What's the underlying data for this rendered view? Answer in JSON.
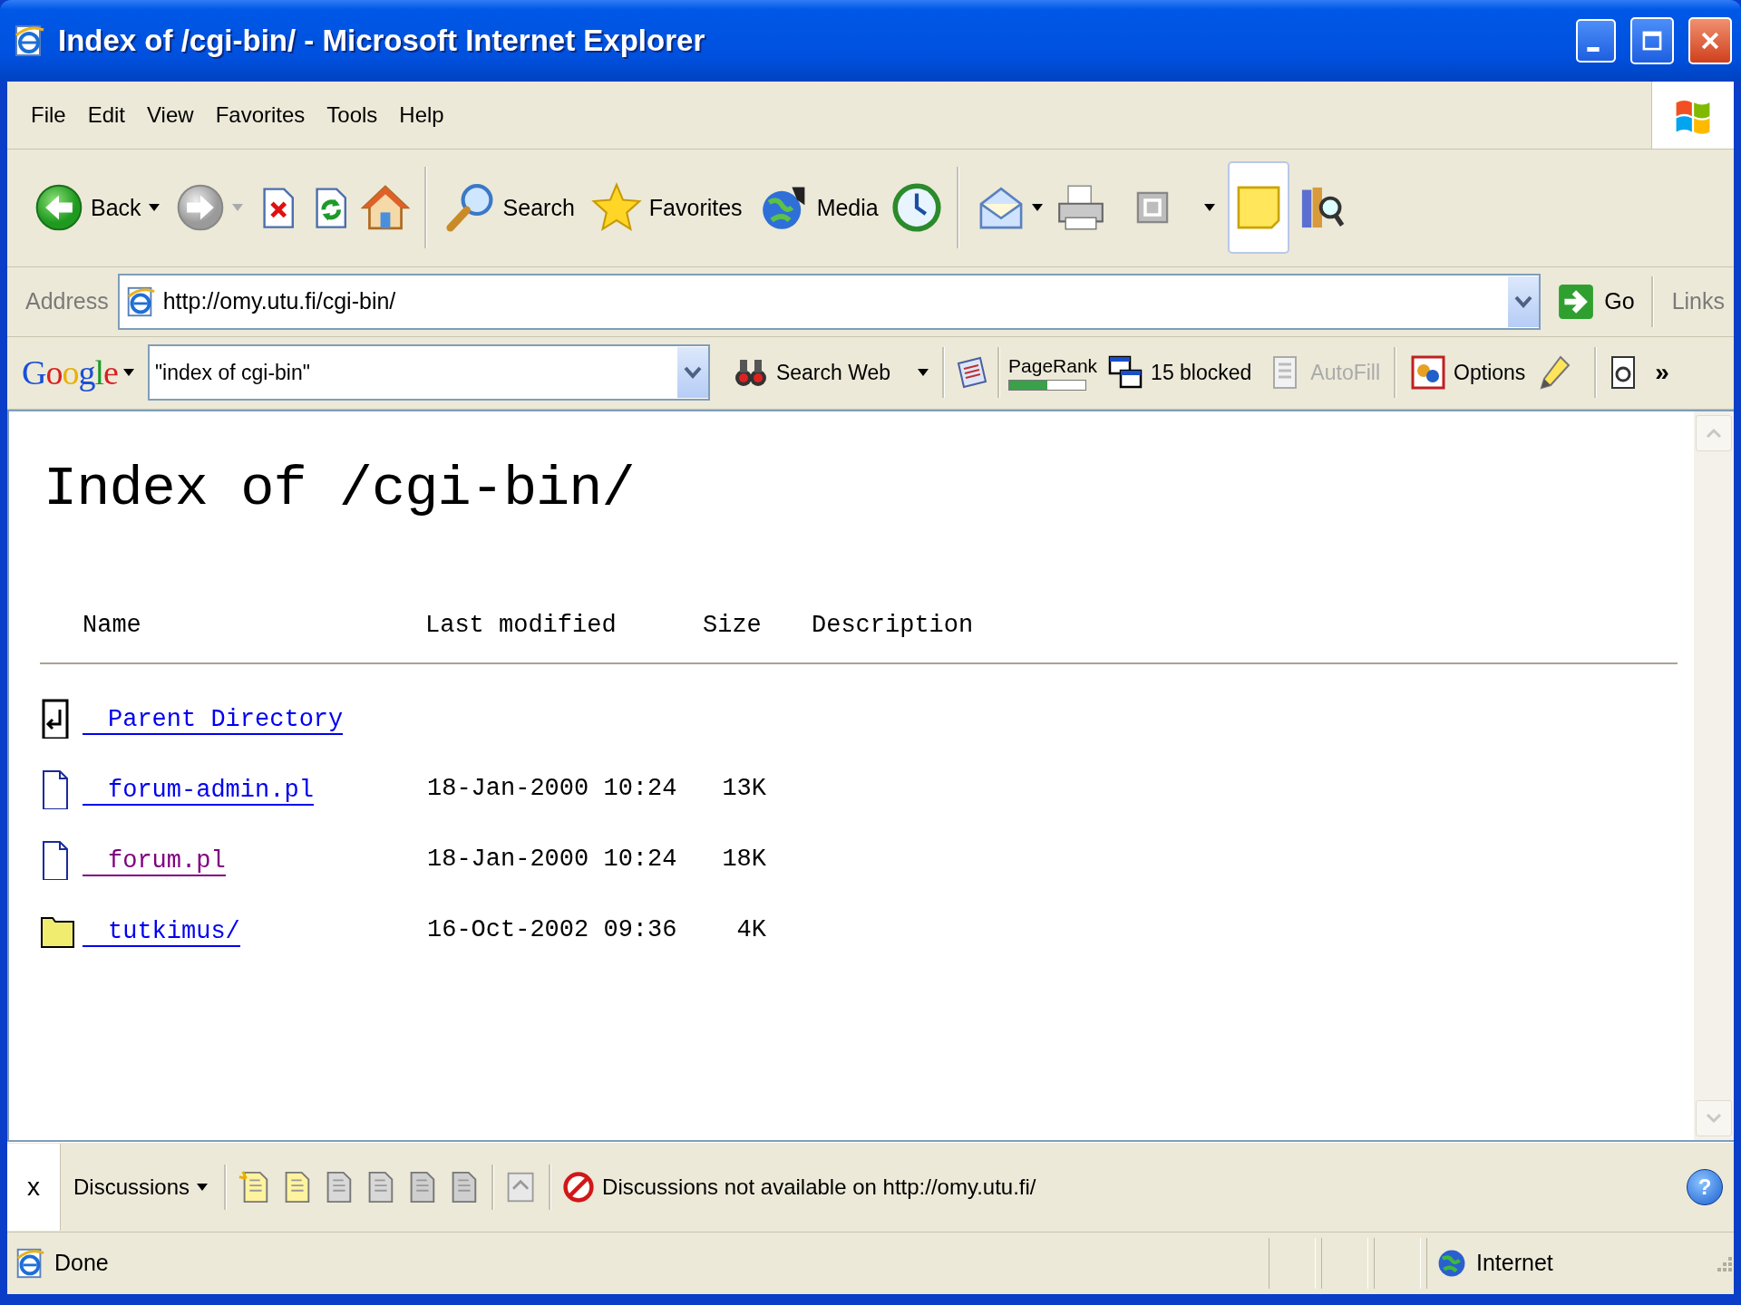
{
  "window": {
    "title": "Index of /cgi-bin/ - Microsoft Internet Explorer"
  },
  "menu": [
    "File",
    "Edit",
    "View",
    "Favorites",
    "Tools",
    "Help"
  ],
  "toolbar": {
    "back": {
      "label": "Back",
      "disabled": false
    },
    "forward": {
      "disabled": true
    },
    "search": "Search",
    "favorites": "Favorites",
    "media": "Media",
    "messenger": {
      "highlighted": true
    }
  },
  "address": {
    "label": "Address",
    "value": "http://omy.utu.fi/cgi-bin/",
    "go": "Go",
    "links": "Links"
  },
  "google_bar": {
    "logo": "Google",
    "query": "\"index of cgi-bin\"",
    "search_web": "Search Web",
    "pagerank": {
      "label": "PageRank",
      "level": 0.5
    },
    "popups": "15 blocked",
    "autofill": {
      "label": "AutoFill",
      "disabled": true
    },
    "options": "Options",
    "more": "»"
  },
  "page": {
    "heading": "Index of /cgi-bin/",
    "columns": [
      "Name",
      "Last modified",
      "Size",
      "Description"
    ],
    "rows": [
      {
        "kind": "parent",
        "name": "Parent Directory",
        "visited": false
      },
      {
        "kind": "file",
        "name": "forum-admin.pl",
        "modified": "18-Jan-2000 10:24",
        "size": "13K",
        "visited": false
      },
      {
        "kind": "file",
        "name": "forum.pl",
        "modified": "18-Jan-2000 10:24",
        "size": "18K",
        "visited": true
      },
      {
        "kind": "folder",
        "name": "tutkimus/",
        "modified": "16-Oct-2002 09:36",
        "size": "4K",
        "visited": false
      }
    ]
  },
  "discussions": {
    "close": "x",
    "label": "Discussions",
    "message": "Discussions not available on http://omy.utu.fi/",
    "help": "?"
  },
  "status_bar": {
    "text": "Done",
    "zone": "Internet"
  }
}
